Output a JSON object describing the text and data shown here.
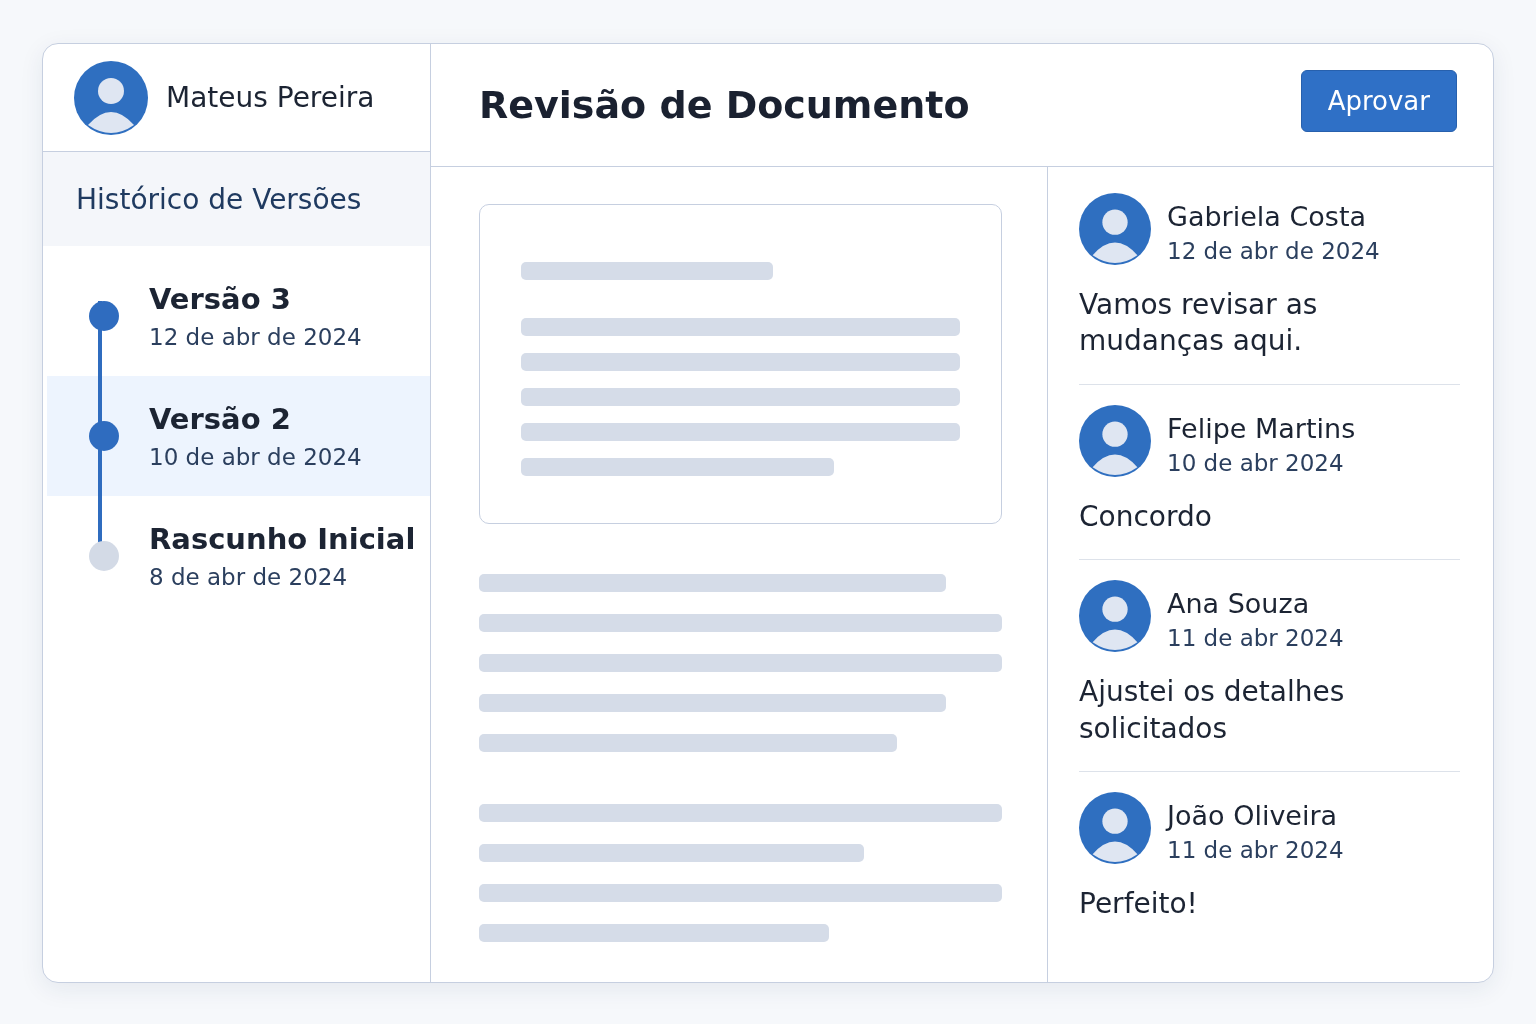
{
  "user": {
    "name": "Mateus Pereira"
  },
  "header": {
    "title": "Revisão de Documento",
    "approve_button": "Aprovar"
  },
  "history": {
    "title": "Histórico de Versões",
    "versions": [
      {
        "name": "Versão 3",
        "date": "12 de abr de 2024",
        "selected": false,
        "reached": true
      },
      {
        "name": "Versão 2",
        "date": "10 de abr de 2024",
        "selected": true,
        "reached": true
      },
      {
        "name": "Rascunho Inicial",
        "date": "8 de abr de 2024",
        "selected": false,
        "reached": false
      }
    ]
  },
  "comments": [
    {
      "author": "Gabriela Costa",
      "date": "12 de abr de 2024",
      "text": "Vamos revisar as mudanças aqui."
    },
    {
      "author": "Felipe Martins",
      "date": "10 de abr 2024",
      "text": "Concordo"
    },
    {
      "author": "Ana Souza",
      "date": "11 de abr 2024",
      "text": "Ajustei os detalhes solicitados"
    },
    {
      "author": "João Oliveira",
      "date": "11 de abr 2024",
      "text": "Perfeito!"
    }
  ]
}
